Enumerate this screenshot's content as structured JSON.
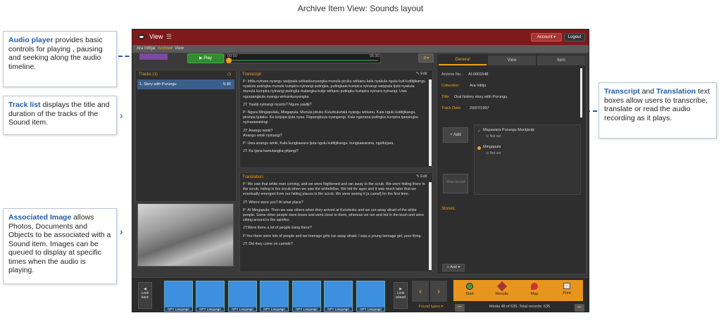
{
  "page_title": "Archive Item View: Sounds layout",
  "callouts": {
    "audio": {
      "head": "Audio player",
      "body": " provides basic controls for playing , pausing and seeking along the audio timeline."
    },
    "tracks": {
      "head": "Track list",
      "body": " displays the title and duration of the tracks of the Sound item."
    },
    "image": {
      "head": "Associated Image",
      "body": " allows Photos, Documents and Objects to be associated with a Sound item.  Images can be queued to display at specific times when the audio is playing."
    },
    "transcript": {
      "head1": "Transcript",
      "mid": " and ",
      "head2": "Translation",
      "body": " text boxes allow users to transcribe, translate or read the audio recording as it plays."
    }
  },
  "app": {
    "view_label": "View",
    "account_label": "Account ▾",
    "logout_label": "Logout",
    "breadcrumb": [
      "Ara Irititja",
      "Archive",
      "View"
    ],
    "play_label": "▶ Play",
    "time_start": "00:00",
    "time_end": "05:30",
    "tracks_header": "Tracks (1)",
    "track_title": "1. Story with Purungu",
    "track_duration": "5:30",
    "transcript_header": "Transcript:",
    "translation_header": "Translation:",
    "edit_label": "✎ Edit",
    "transcript_lines": [
      "P: Iritila nyinara nyangu walypala wirkankunyangka munula piruku wirkanu kala nyakula ngulu kuti-kuttitjikangu nyakula putingka munula kumpira nyinangi putingka, putingkala kumpira nyinangi walypala tjuta nyakula munula kumpira nyinangi putingka malangka kutju wirkanu putingku kumpira nyinara nyinangi. Uwa ngurpangkula nyangu wirkankunyangka.",
      "JT: Yaaltji nyinangi nyuntu? Ngura yaaltji?",
      "P: Ngura Mingapulala, Mingapula. Munula piruku Kulurkulurtala nyangu wirkanu. Kala ngulu kuttitjikangu, piranpa tjutaku. Ka kutjupa tjuta nyaa. Rapangkuya nyangangi, Kala nganana putingka kumpira tjanpingka nyinarawaningi.",
      "JT: Anangu winki?",
      "Anangu winki nyinangi?",
      "P: Uwa anangu winki, Kala kungkawara tjuta ngulu kuttitjikangu. kungkawarana, ngaltutjara.",
      "JT: Ka tjana kamulangka pitjangi?"
    ],
    "translation_lines": [
      "P: We saw that white man coming, and we were frightened and ran away to the scrub. We were hiding there in the scrub, hiding in the scrub when we saw the whitefellas. We hid for ages and it was much later that we eventually emerged from our hiding places in the scrub. We were seeing it [a camel] for the first time.",
      "JT: Where were you? At what place?",
      "P: At Mingapula. Then we saw others when they arrived at Kulurkulur and we ran away afraid of the white people. Some other people were brave and went close to them, whereas we ran and hid in the bush and were sitting around in the spinifex.",
      "JT:Were there a lot of people living there?",
      "P:Yes there were lots of people and we teenage girls ran away afraid. I was a young teenage girl, poor thing.",
      "JT: Did they come on camels?"
    ],
    "tabs": [
      "General",
      "View",
      "Item"
    ],
    "fields": [
      {
        "label": "Archive No.:",
        "value": "AI-0001548"
      },
      {
        "label": "Collection:",
        "value": "Ara Irititja"
      },
      {
        "label": "Title:",
        "value": "Oral history story with Purungu."
      },
      {
        "label": "Track Date:",
        "value": "29/07/1997"
      }
    ],
    "add_label": "+ Add",
    "view_record_label": "View record",
    "people": [
      {
        "name": "Mayawara Purungu Muntjantji",
        "status": "Not set"
      },
      {
        "name": "Mingapula",
        "status": "Not set"
      }
    ],
    "stories_label": "Stories:",
    "add_menu_label": "+ Add ▾",
    "look_back": "Look back",
    "look_ahead": "Look ahead",
    "thumb_label": "NPY Language",
    "found_types": "Found types ▾",
    "actions": [
      "Start",
      "Results",
      "Map",
      "Print"
    ],
    "record_info": "Media 48 of 635.  Total records: 635"
  }
}
